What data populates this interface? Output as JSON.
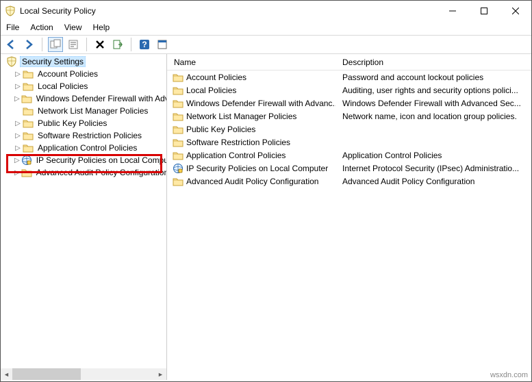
{
  "window": {
    "title": "Local Security Policy"
  },
  "menu": {
    "file": "File",
    "action": "Action",
    "view": "View",
    "help": "Help"
  },
  "tree": {
    "root": "Security Settings",
    "items": [
      "Account Policies",
      "Local Policies",
      "Windows Defender Firewall with Adva",
      "Network List Manager Policies",
      "Public Key Policies",
      "Software Restriction Policies",
      "Application Control Policies",
      "IP Security Policies on Local Compute",
      "Advanced Audit Policy Configuration"
    ]
  },
  "list": {
    "col_name": "Name",
    "col_desc": "Description",
    "rows": [
      {
        "name": "Account Policies",
        "desc": "Password and account lockout policies",
        "icon": "folder"
      },
      {
        "name": "Local Policies",
        "desc": "Auditing, user rights and security options polici...",
        "icon": "folder"
      },
      {
        "name": "Windows Defender Firewall with Advanc...",
        "desc": "Windows Defender Firewall with Advanced Sec...",
        "icon": "folder"
      },
      {
        "name": "Network List Manager Policies",
        "desc": "Network name, icon and location group policies.",
        "icon": "folder"
      },
      {
        "name": "Public Key Policies",
        "desc": "",
        "icon": "folder"
      },
      {
        "name": "Software Restriction Policies",
        "desc": "",
        "icon": "folder"
      },
      {
        "name": "Application Control Policies",
        "desc": "Application Control Policies",
        "icon": "folder"
      },
      {
        "name": "IP Security Policies on Local Computer",
        "desc": "Internet Protocol Security (IPsec) Administratio...",
        "icon": "ipsec"
      },
      {
        "name": "Advanced Audit Policy Configuration",
        "desc": "Advanced Audit Policy Configuration",
        "icon": "folder"
      }
    ]
  },
  "watermark": "wsxdn.com"
}
